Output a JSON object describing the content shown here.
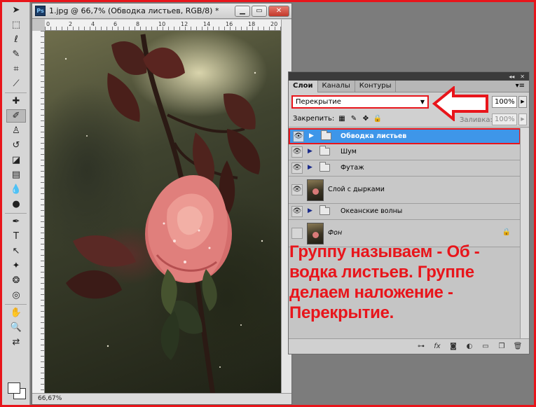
{
  "document": {
    "app_badge": "Ps",
    "title": "1.jpg @ 66,7% (Обводка листьев, RGB/8) *",
    "minimize": "▁",
    "maximize": "▭",
    "close": "✕",
    "ruler_ticks": [
      "0",
      "2",
      "4",
      "6",
      "8",
      "10",
      "12",
      "14",
      "16",
      "18",
      "20"
    ],
    "zoom_status": "66,67%"
  },
  "tools": [
    {
      "name": "move-tool-icon",
      "glyph": "➤"
    },
    {
      "name": "marquee-tool-icon",
      "glyph": "⬚"
    },
    {
      "name": "lasso-tool-icon",
      "glyph": "ℓ"
    },
    {
      "name": "quick-select-tool-icon",
      "glyph": "✎"
    },
    {
      "name": "crop-tool-icon",
      "glyph": "⌗"
    },
    {
      "name": "eyedropper-tool-icon",
      "glyph": "⟋"
    },
    {
      "name": "healing-brush-tool-icon",
      "glyph": "✚"
    },
    {
      "name": "brush-tool-icon",
      "glyph": "✐"
    },
    {
      "name": "clone-stamp-tool-icon",
      "glyph": "♙"
    },
    {
      "name": "history-brush-tool-icon",
      "glyph": "↺"
    },
    {
      "name": "eraser-tool-icon",
      "glyph": "◪"
    },
    {
      "name": "gradient-tool-icon",
      "glyph": "▤"
    },
    {
      "name": "blur-tool-icon",
      "glyph": "💧"
    },
    {
      "name": "dodge-tool-icon",
      "glyph": "●"
    },
    {
      "name": "pen-tool-icon",
      "glyph": "✒"
    },
    {
      "name": "type-tool-icon",
      "glyph": "T"
    },
    {
      "name": "path-select-tool-icon",
      "glyph": "↖"
    },
    {
      "name": "shape-tool-icon",
      "glyph": "✦"
    },
    {
      "name": "3d-rotate-tool-icon",
      "glyph": "❂"
    },
    {
      "name": "3d-orbit-tool-icon",
      "glyph": "◎"
    },
    {
      "name": "hand-tool-icon",
      "glyph": "✋"
    },
    {
      "name": "zoom-tool-icon",
      "glyph": "🔍"
    },
    {
      "name": "swap-colors-icon",
      "glyph": "⇄"
    }
  ],
  "layers_panel": {
    "tabs": [
      "Слои",
      "Каналы",
      "Контуры"
    ],
    "active_tab": 0,
    "blend_mode": "Перекрытие",
    "opacity_label": "ь:",
    "opacity_value": "100%",
    "lock_label": "Закрепить:",
    "fill_label": "Заливка:",
    "fill_value": "100%",
    "layers": [
      {
        "name": "Обводка листьев",
        "type": "group",
        "visible": true,
        "selected": true
      },
      {
        "name": "Шум",
        "type": "group",
        "visible": true,
        "selected": false
      },
      {
        "name": "Футаж",
        "type": "group",
        "visible": true,
        "selected": false
      },
      {
        "name": "Слой с дырками",
        "type": "image",
        "visible": true,
        "selected": false
      },
      {
        "name": "Океанские волны",
        "type": "group",
        "visible": true,
        "selected": false
      },
      {
        "name": "Фон",
        "type": "background",
        "visible": false,
        "selected": false,
        "locked": true
      }
    ]
  },
  "annotation": {
    "text": "Группу называем - Об -\nводка листьев. Группе\nделаем наложение -\nПерекрытие.",
    "color": "#e8151b"
  },
  "colors": {
    "accent_red": "#e8151b",
    "selection_blue": "#3e96e9"
  }
}
